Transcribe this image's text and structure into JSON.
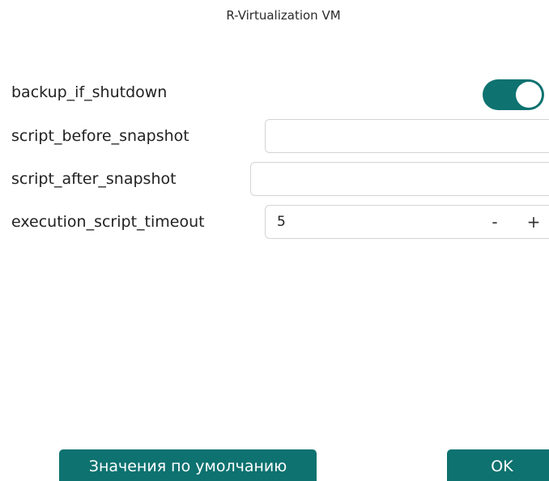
{
  "dialog": {
    "title": "R-Virtualization VM"
  },
  "fields": {
    "backup_if_shutdown": {
      "label": "backup_if_shutdown",
      "enabled": true
    },
    "script_before_snapshot": {
      "label": "script_before_snapshot",
      "value": ""
    },
    "script_after_snapshot": {
      "label": "script_after_snapshot",
      "value": ""
    },
    "execution_script_timeout": {
      "label": "execution_script_timeout",
      "value": "5",
      "decrement": "-",
      "increment": "+"
    }
  },
  "footer": {
    "defaults_label": "Значения по умолчанию",
    "ok_label": "OK"
  },
  "colors": {
    "accent": "#0d7270",
    "border": "#d4d4d4",
    "text": "#222222"
  }
}
